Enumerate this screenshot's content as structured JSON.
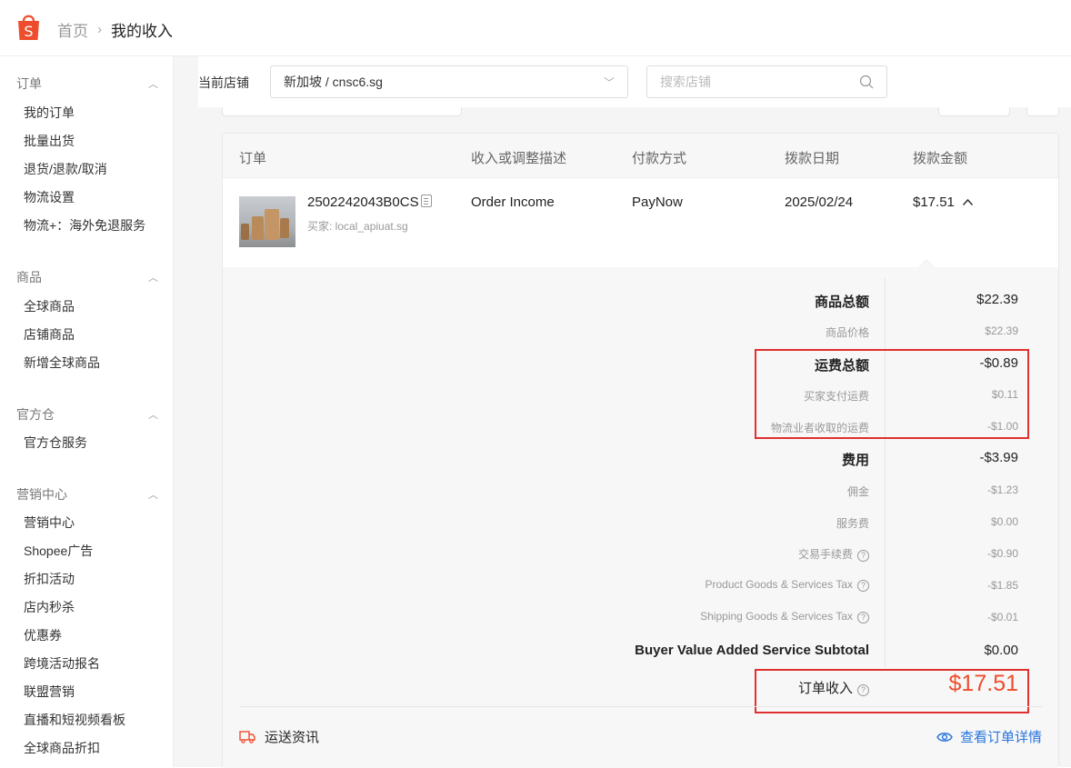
{
  "breadcrumb": {
    "home": "首页",
    "current": "我的收入"
  },
  "sidebar": {
    "sections": [
      {
        "title": "订单",
        "items": [
          "我的订单",
          "批量出货",
          "退货/退款/取消",
          "物流设置",
          "物流+：海外免退服务"
        ]
      },
      {
        "title": "商品",
        "items": [
          "全球商品",
          "店铺商品",
          "新增全球商品"
        ]
      },
      {
        "title": "官方仓",
        "items": [
          "官方仓服务"
        ]
      },
      {
        "title": "营销中心",
        "items": [
          "营销中心",
          "Shopee广告",
          "折扣活动",
          "店内秒杀",
          "优惠券",
          "跨境活动报名",
          "联盟营销",
          "直播和短视频看板",
          "全球商品折扣"
        ]
      }
    ]
  },
  "shop": {
    "label": "当前店铺",
    "selected": "新加坡 / cnsc6.sg",
    "search_placeholder": "搜索店铺"
  },
  "table": {
    "headers": [
      "订单",
      "收入或调整描述",
      "付款方式",
      "拨款日期",
      "拨款金额"
    ],
    "row": {
      "order_id": "2502242043B0CS",
      "buyer": "买家: local_apiuat.sg",
      "description": "Order Income",
      "payment": "PayNow",
      "date": "2025/02/24",
      "amount": "$17.51"
    }
  },
  "breakdown": [
    {
      "label": "商品总额",
      "value": "$22.39",
      "style": "b"
    },
    {
      "label": "商品价格",
      "value": "$22.39",
      "style": "s"
    },
    {
      "label": "运费总额",
      "value": "-$0.89",
      "style": "b"
    },
    {
      "label": "买家支付运费",
      "value": "$0.11",
      "style": "s"
    },
    {
      "label": "物流业者收取的运费",
      "value": "-$1.00",
      "style": "s"
    },
    {
      "label": "费用",
      "value": "-$3.99",
      "style": "b"
    },
    {
      "label": "佣金",
      "value": "-$1.23",
      "style": "s"
    },
    {
      "label": "服务费",
      "value": "$0.00",
      "style": "s"
    },
    {
      "label": "交易手续费",
      "value": "-$0.90",
      "style": "s",
      "help": true
    },
    {
      "label": "Product Goods & Services Tax",
      "value": "-$1.85",
      "style": "s",
      "help": true
    },
    {
      "label": "Shipping Goods & Services Tax",
      "value": "-$0.01",
      "style": "s",
      "help": true
    },
    {
      "label": "Buyer Value Added Service Subtotal",
      "value": "$0.00",
      "style": "b"
    }
  ],
  "order_income": {
    "label": "订单收入",
    "value": "$17.51"
  },
  "footer": {
    "shipping_info": "运送资讯",
    "view_details": "查看订单详情"
  },
  "colors": {
    "brand": "#ee4d2d",
    "link": "#2673dd",
    "highlight": "#e03030"
  },
  "icons": [
    "shopee-logo-icon",
    "chevron-right-icon",
    "chevron-up-icon",
    "chevron-down-icon",
    "search-icon",
    "copy-icon",
    "help-icon",
    "truck-icon",
    "eye-icon"
  ]
}
